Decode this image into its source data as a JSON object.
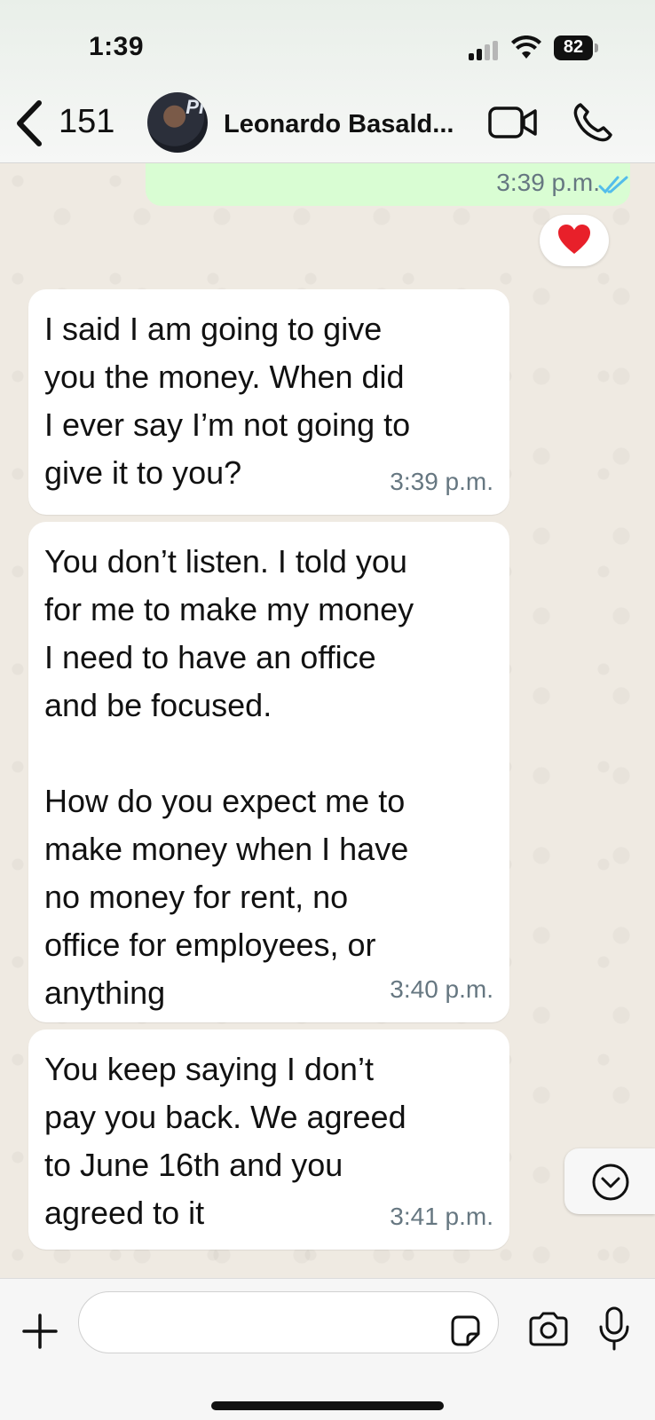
{
  "status_bar": {
    "time": "1:39",
    "battery": "82"
  },
  "header": {
    "back_count": "151",
    "contact_name": "Leonardo Basald...",
    "avatar_logo": "PI"
  },
  "messages": [
    {
      "direction": "out",
      "time": "3:39 p.m.",
      "status": "read",
      "reaction": "heart"
    },
    {
      "direction": "in",
      "text": "I said I am going to give\nyou the money. When did\nI ever say I’m not going to\ngive it to you?",
      "time": "3:39 p.m."
    },
    {
      "direction": "in",
      "text": "You don’t listen. I told you\nfor me to make my money\nI need to have an office\nand be focused.\n\nHow do you expect me to\nmake money when I have\nno money for rent, no\noffice for employees, or\nanything",
      "time": "3:40 p.m."
    },
    {
      "direction": "in",
      "text": "You keep saying I don’t\npay you back. We agreed\nto June 16th and you\nagreed to it",
      "time": "3:41 p.m."
    }
  ],
  "input": {
    "placeholder": ""
  },
  "colors": {
    "outgoing_bubble": "#d9fdd3",
    "incoming_bubble": "#ffffff",
    "read_ticks": "#53bdeb",
    "chat_bg": "#efeae2"
  }
}
